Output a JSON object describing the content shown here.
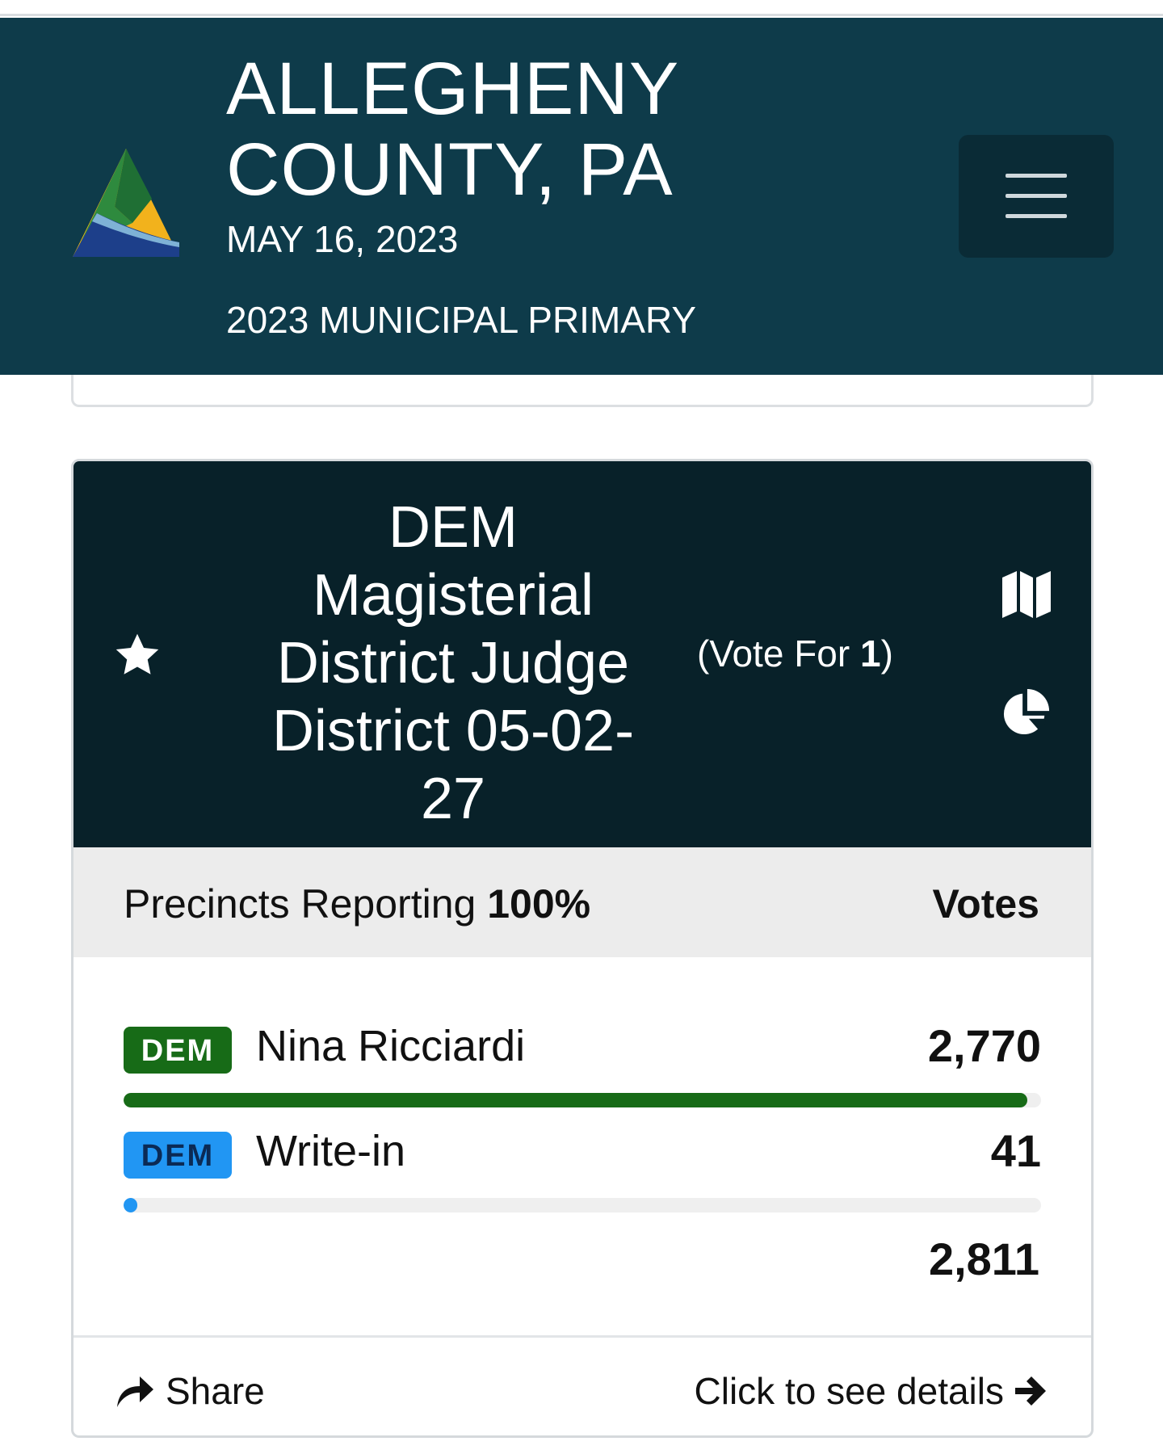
{
  "header": {
    "county_line1": "ALLEGHENY",
    "county_line2": "COUNTY, PA",
    "date": "MAY 16, 2023",
    "election": "2023 MUNICIPAL PRIMARY",
    "menu_icon": "hamburger-menu-icon"
  },
  "race": {
    "title_lines": [
      "DEM",
      "Magisterial",
      "District Judge",
      "District 05-02-",
      "27"
    ],
    "vote_for_prefix": "(Vote For ",
    "vote_for_number": "1",
    "vote_for_suffix": ")",
    "icons": [
      "star-icon",
      "map-icon",
      "pie-chart-icon"
    ],
    "precincts_label": "Precincts Reporting",
    "precincts_value": "100%",
    "votes_header": "Votes",
    "candidates": [
      {
        "party": "DEM",
        "name": "Nina Ricciardi",
        "votes": "2,770",
        "share": 0.9854,
        "color": "#176b17"
      },
      {
        "party": "DEM",
        "name": "Write-in",
        "votes": "41",
        "share": 0.0146,
        "color": "#2196f3"
      }
    ],
    "total_votes": "2,811",
    "share_label": "Share",
    "details_label": "Click to see details"
  },
  "colors": {
    "header_bg": "#0e3b4a",
    "race_header_bg": "#082129",
    "dem_green": "#176b17",
    "write_in_blue": "#2196f3"
  }
}
